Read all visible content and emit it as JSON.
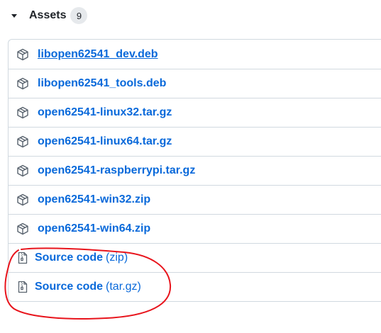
{
  "assets": {
    "title": "Assets",
    "count": "9",
    "toggle_icon": "triangle-down-icon",
    "package_icon": "package-icon",
    "zip_icon": "file-zip-icon",
    "items": [
      {
        "name": "libopen62541_dev.deb"
      },
      {
        "name": "libopen62541_tools.deb"
      },
      {
        "name": "open62541-linux32.tar.gz"
      },
      {
        "name": "open62541-linux64.tar.gz"
      },
      {
        "name": "open62541-raspberrypi.tar.gz"
      },
      {
        "name": "open62541-win32.zip"
      },
      {
        "name": "open62541-win64.zip"
      }
    ],
    "source": [
      {
        "label": "Source code",
        "format": "(zip)"
      },
      {
        "label": "Source code",
        "format": "(tar.gz)"
      }
    ]
  },
  "colors": {
    "link": "#0969da",
    "border": "#d1d9e0",
    "badge_bg": "#e6e9ec",
    "annotation": "#e8141c"
  }
}
